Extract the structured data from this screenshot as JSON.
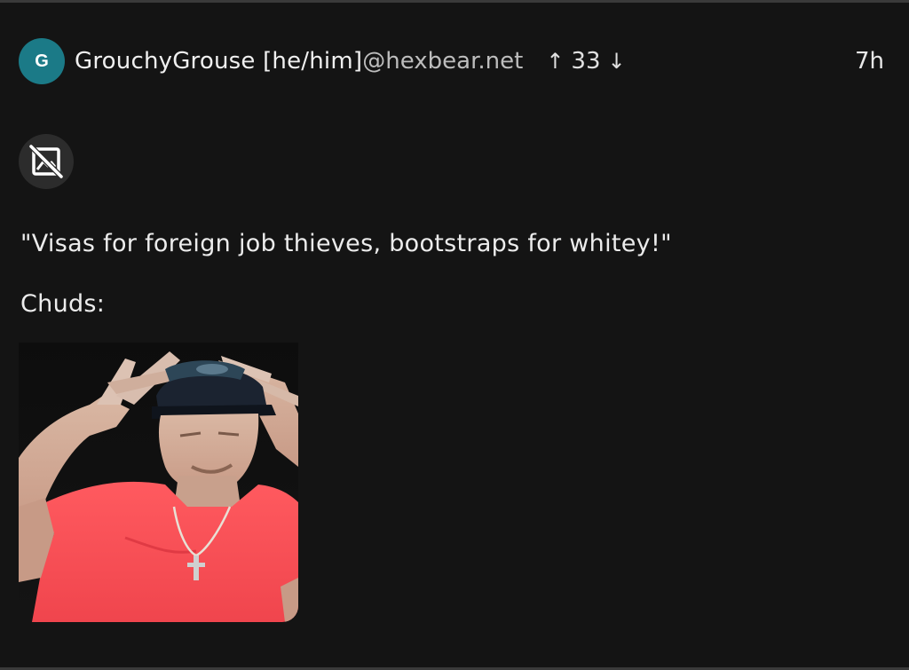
{
  "post": {
    "avatar_initial": "G",
    "author_name": "GrouchyGrouse [he/him]",
    "instance": "@hexbear.net",
    "upvote_symbol": "↑",
    "score": "33",
    "downvote_symbol": "↓",
    "time_ago": "7h",
    "quote_text": "\"Visas for foreign job thieves, bootstraps for whitey!\"",
    "label_text": "Chuds:"
  },
  "icons": {
    "broken_image": "image-off-icon",
    "upvote": "arrow-up-icon",
    "downvote": "arrow-down-icon"
  },
  "colors": {
    "background": "#141414",
    "avatar": "#1b7a87",
    "text": "#ececec",
    "muted_text": "#bdbdbd"
  }
}
